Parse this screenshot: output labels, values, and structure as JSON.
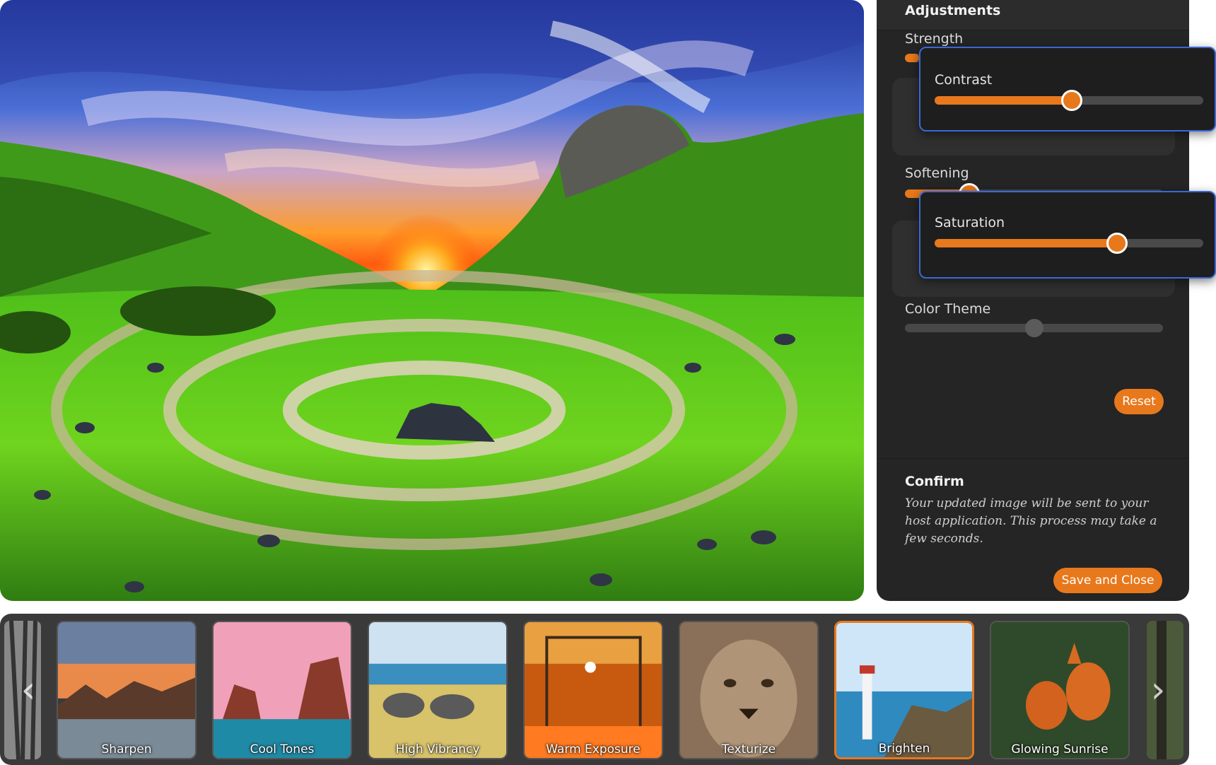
{
  "adjustments": {
    "title": "Adjustments",
    "strength": {
      "label": "Strength",
      "value_percent": 6
    },
    "contrast": {
      "label": "Contrast",
      "value_percent": 51
    },
    "softening": {
      "label": "Softening",
      "value_percent": 25
    },
    "saturation": {
      "label": "Saturation",
      "value_percent": 68
    },
    "color_theme": {
      "label": "Color Theme",
      "value_percent": 50
    },
    "reset_label": "Reset"
  },
  "confirm": {
    "title": "Confirm",
    "text": "Your updated image will be sent to your host application. This process may take a few seconds.",
    "save_label": "Save and Close"
  },
  "filters": {
    "items": [
      {
        "label": "Sharpen"
      },
      {
        "label": "Cool Tones"
      },
      {
        "label": "High Vibrancy"
      },
      {
        "label": "Warm Exposure"
      },
      {
        "label": "Texturize"
      },
      {
        "label": "Brighten"
      },
      {
        "label": "Glowing Sunrise"
      }
    ],
    "active_index": 5,
    "prev_icon": "chevron-left-icon",
    "next_icon": "chevron-right-icon"
  },
  "colors": {
    "accent": "#e8781c",
    "panel_bg": "#252525",
    "popup_border": "#3a68d8"
  }
}
